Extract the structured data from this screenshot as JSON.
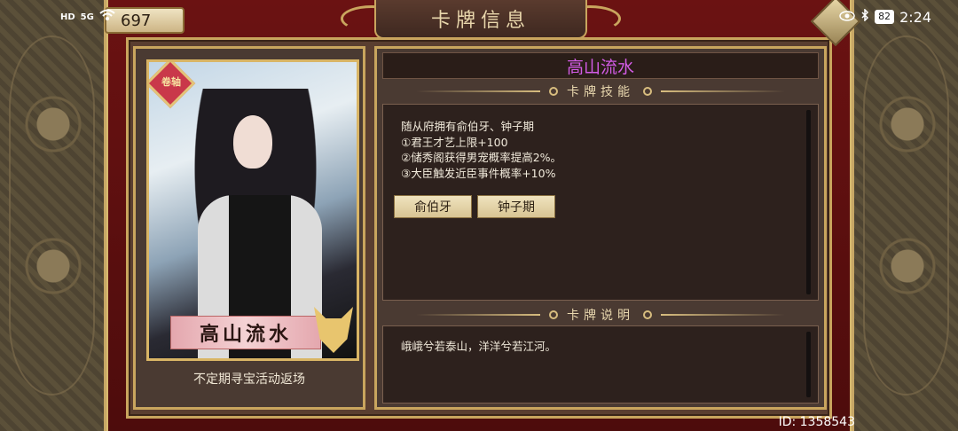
{
  "status_bar": {
    "network": "HD",
    "signal": "5G",
    "battery": "82",
    "time": "2:24"
  },
  "currency": {
    "value": "697"
  },
  "header": {
    "title": "卡牌信息"
  },
  "card": {
    "badge": "卷轴",
    "name": "高山流水",
    "source": "不定期寻宝活动返场"
  },
  "info": {
    "title": "高山流水",
    "skills_header": "卡牌技能",
    "skills_lines": [
      "随从府拥有俞伯牙、钟子期",
      "①君王才艺上限+100",
      "②储秀阁获得男宠概率提高2%。",
      "③大臣触发近臣事件概率+10%"
    ],
    "skill_buttons": [
      "俞伯牙",
      "钟子期"
    ],
    "desc_header": "卡牌说明",
    "desc_text": "峨峨兮若泰山，洋洋兮若江河。"
  },
  "footer": {
    "id": "ID: 1358543"
  },
  "colors": {
    "frame_red": "#6b1212",
    "gold": "#c9a55e",
    "title_purple": "#d35ce6"
  }
}
